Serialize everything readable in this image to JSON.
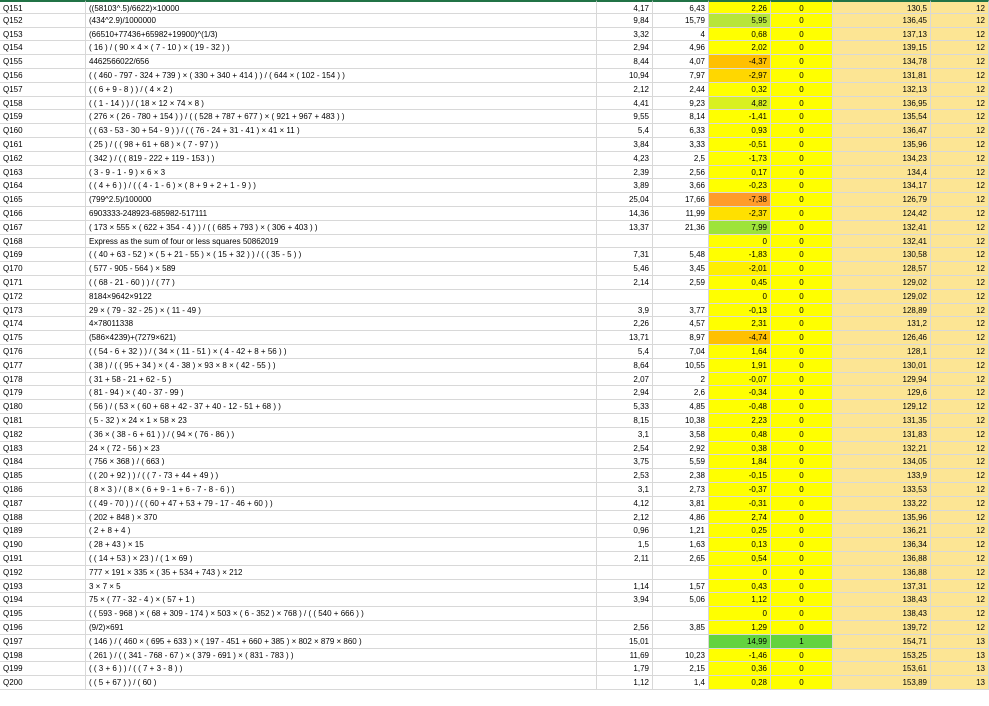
{
  "sheet": {
    "rows": [
      {
        "id": "Q151",
        "q": "((58103^.5)/6622)×10000",
        "n1": "4,17",
        "n2": "6,43",
        "diff": "2,26",
        "diff_color": "#ffff00",
        "flag": "0",
        "score": "130,5",
        "lvl": "12"
      },
      {
        "id": "Q152",
        "q": "(434^2.9)/1000000",
        "n1": "9,84",
        "n2": "15,79",
        "diff": "5,95",
        "diff_color": "#b7e53b",
        "flag": "0",
        "score": "136,45",
        "lvl": "12"
      },
      {
        "id": "Q153",
        "q": "(66510+77436+65982+19900)^(1/3)",
        "n1": "3,32",
        "n2": "4",
        "diff": "0,68",
        "diff_color": "#ffff00",
        "flag": "0",
        "score": "137,13",
        "lvl": "12"
      },
      {
        "id": "Q154",
        "q": "( 16 ) / ( 90 × 4 × ( 7 - 10 ) × ( 19 - 32 ) )",
        "n1": "2,94",
        "n2": "4,96",
        "diff": "2,02",
        "diff_color": "#ffff00",
        "flag": "0",
        "score": "139,15",
        "lvl": "12"
      },
      {
        "id": "Q155",
        "q": "4462566022/656",
        "n1": "8,44",
        "n2": "4,07",
        "diff": "-4,37",
        "diff_color": "#ffc000",
        "flag": "0",
        "score": "134,78",
        "lvl": "12"
      },
      {
        "id": "Q156",
        "q": "( ( 460 - 797 - 324 + 739 ) × ( 330 + 340 + 414 ) ) / ( 644 × ( 102 - 154 ) )",
        "n1": "10,94",
        "n2": "7,97",
        "diff": "-2,97",
        "diff_color": "#ffd700",
        "flag": "0",
        "score": "131,81",
        "lvl": "12"
      },
      {
        "id": "Q157",
        "q": "( ( 6 + 9 - 8 ) ) / ( 4 × 2 )",
        "n1": "2,12",
        "n2": "2,44",
        "diff": "0,32",
        "diff_color": "#ffff00",
        "flag": "0",
        "score": "132,13",
        "lvl": "12"
      },
      {
        "id": "Q158",
        "q": "( ( 1 - 14 ) ) / ( 18 × 12 × 74 × 8 )",
        "n1": "4,41",
        "n2": "9,23",
        "diff": "4,82",
        "diff_color": "#d9f020",
        "flag": "0",
        "score": "136,95",
        "lvl": "12"
      },
      {
        "id": "Q159",
        "q": "( 276 × ( 26 - 780 + 154 ) ) / ( ( 528 + 787 + 677 ) × ( 921 + 967 + 483 ) )",
        "n1": "9,55",
        "n2": "8,14",
        "diff": "-1,41",
        "diff_color": "#ffff00",
        "flag": "0",
        "score": "135,54",
        "lvl": "12"
      },
      {
        "id": "Q160",
        "q": "( ( 63 - 53 - 30 + 54 - 9 ) ) / ( ( 76 - 24 + 31 - 41 ) × 41 × 11 )",
        "n1": "5,4",
        "n2": "6,33",
        "diff": "0,93",
        "diff_color": "#ffff00",
        "flag": "0",
        "score": "136,47",
        "lvl": "12"
      },
      {
        "id": "Q161",
        "q": "( 25 ) / ( ( 98 + 61 + 68 ) × ( 7 - 97 ) )",
        "n1": "3,84",
        "n2": "3,33",
        "diff": "-0,51",
        "diff_color": "#ffff00",
        "flag": "0",
        "score": "135,96",
        "lvl": "12"
      },
      {
        "id": "Q162",
        "q": "( 342 ) / ( ( 819 - 222 + 119 - 153 ) )",
        "n1": "4,23",
        "n2": "2,5",
        "diff": "-1,73",
        "diff_color": "#ffff00",
        "flag": "0",
        "score": "134,23",
        "lvl": "12"
      },
      {
        "id": "Q163",
        "q": "( 3 - 9 - 1 - 9 ) × 6 × 3",
        "n1": "2,39",
        "n2": "2,56",
        "diff": "0,17",
        "diff_color": "#ffff00",
        "flag": "0",
        "score": "134,4",
        "lvl": "12"
      },
      {
        "id": "Q164",
        "q": "( ( 4 + 6 ) ) / ( ( 4 - 1 - 6 ) × ( 8 + 9 + 2 + 1 - 9 ) )",
        "n1": "3,89",
        "n2": "3,66",
        "diff": "-0,23",
        "diff_color": "#ffff00",
        "flag": "0",
        "score": "134,17",
        "lvl": "12"
      },
      {
        "id": "Q165",
        "q": "(799^2.5)/100000",
        "n1": "25,04",
        "n2": "17,66",
        "diff": "-7,38",
        "diff_color": "#ff9c2a",
        "flag": "0",
        "score": "126,79",
        "lvl": "12"
      },
      {
        "id": "Q166",
        "q": "6903333-248923-685982-517111",
        "n1": "14,36",
        "n2": "11,99",
        "diff": "-2,37",
        "diff_color": "#ffe000",
        "flag": "0",
        "score": "124,42",
        "lvl": "12"
      },
      {
        "id": "Q167",
        "q": "( 173 × 555 × ( 622 + 354 - 4 ) ) / ( ( 685 + 793 ) × ( 306 + 403 ) )",
        "n1": "13,37",
        "n2": "21,36",
        "diff": "7,99",
        "diff_color": "#9ee33a",
        "flag": "0",
        "score": "132,41",
        "lvl": "12"
      },
      {
        "id": "Q168",
        "q": "Express as the sum of four or less squares 50862019",
        "n1": "",
        "n2": "",
        "diff": "0",
        "diff_color": "#ffff00",
        "flag": "0",
        "score": "132,41",
        "lvl": "12"
      },
      {
        "id": "Q169",
        "q": "( ( 40 + 63 - 52 ) × ( 5 + 21 - 55 ) × ( 15 + 32 ) ) / ( ( 35 - 5 ) )",
        "n1": "7,31",
        "n2": "5,48",
        "diff": "-1,83",
        "diff_color": "#ffff00",
        "flag": "0",
        "score": "130,58",
        "lvl": "12"
      },
      {
        "id": "Q170",
        "q": "( 577 - 905 - 564 ) × 589",
        "n1": "5,46",
        "n2": "3,45",
        "diff": "-2,01",
        "diff_color": "#ffef00",
        "flag": "0",
        "score": "128,57",
        "lvl": "12"
      },
      {
        "id": "Q171",
        "q": "( ( 68 - 21 - 60 ) ) / ( 77 )",
        "n1": "2,14",
        "n2": "2,59",
        "diff": "0,45",
        "diff_color": "#ffff00",
        "flag": "0",
        "score": "129,02",
        "lvl": "12"
      },
      {
        "id": "Q172",
        "q": "8184×9642×9122",
        "n1": "",
        "n2": "",
        "diff": "0",
        "diff_color": "#ffff00",
        "flag": "0",
        "score": "129,02",
        "lvl": "12"
      },
      {
        "id": "Q173",
        "q": "29 × ( 79 - 32 - 25 ) × ( 11 - 49 )",
        "n1": "3,9",
        "n2": "3,77",
        "diff": "-0,13",
        "diff_color": "#ffff00",
        "flag": "0",
        "score": "128,89",
        "lvl": "12"
      },
      {
        "id": "Q174",
        "q": "4×78011338",
        "n1": "2,26",
        "n2": "4,57",
        "diff": "2,31",
        "diff_color": "#ffff00",
        "flag": "0",
        "score": "131,2",
        "lvl": "12"
      },
      {
        "id": "Q175",
        "q": "(586×4239)+(7279×621)",
        "n1": "13,71",
        "n2": "8,97",
        "diff": "-4,74",
        "diff_color": "#ffc000",
        "flag": "0",
        "score": "126,46",
        "lvl": "12"
      },
      {
        "id": "Q176",
        "q": "( ( 54 - 6 + 32 ) ) / ( 34 × ( 11 - 51 ) × ( 4 - 42 + 8 + 56 ) )",
        "n1": "5,4",
        "n2": "7,04",
        "diff": "1,64",
        "diff_color": "#ffff00",
        "flag": "0",
        "score": "128,1",
        "lvl": "12"
      },
      {
        "id": "Q177",
        "q": "( 38 ) / ( ( 95 + 34 ) × ( 4 - 38 ) × 93 × 8 × ( 42 - 55 ) )",
        "n1": "8,64",
        "n2": "10,55",
        "diff": "1,91",
        "diff_color": "#ffff00",
        "flag": "0",
        "score": "130,01",
        "lvl": "12"
      },
      {
        "id": "Q178",
        "q": "( 31 + 58 - 21 + 62 - 5 )",
        "n1": "2,07",
        "n2": "2",
        "diff": "-0,07",
        "diff_color": "#ffff00",
        "flag": "0",
        "score": "129,94",
        "lvl": "12"
      },
      {
        "id": "Q179",
        "q": "( 81 - 94 ) × ( 40 - 37 - 99 )",
        "n1": "2,94",
        "n2": "2,6",
        "diff": "-0,34",
        "diff_color": "#ffff00",
        "flag": "0",
        "score": "129,6",
        "lvl": "12"
      },
      {
        "id": "Q180",
        "q": "( 56 ) / ( 53 × ( 60 + 68 + 42 - 37 + 40 - 12 - 51 + 68 ) )",
        "n1": "5,33",
        "n2": "4,85",
        "diff": "-0,48",
        "diff_color": "#ffff00",
        "flag": "0",
        "score": "129,12",
        "lvl": "12"
      },
      {
        "id": "Q181",
        "q": "( 5 - 32 ) × 24 × 1 × 58 × 23",
        "n1": "8,15",
        "n2": "10,38",
        "diff": "2,23",
        "diff_color": "#ffff00",
        "flag": "0",
        "score": "131,35",
        "lvl": "12"
      },
      {
        "id": "Q182",
        "q": "( 36 × ( 38 - 6 + 61 ) ) / ( 94 × ( 76 - 86 ) )",
        "n1": "3,1",
        "n2": "3,58",
        "diff": "0,48",
        "diff_color": "#ffff00",
        "flag": "0",
        "score": "131,83",
        "lvl": "12"
      },
      {
        "id": "Q183",
        "q": "24 × ( 72 - 56 ) × 23",
        "n1": "2,54",
        "n2": "2,92",
        "diff": "0,38",
        "diff_color": "#ffff00",
        "flag": "0",
        "score": "132,21",
        "lvl": "12"
      },
      {
        "id": "Q184",
        "q": "( 756 × 368 ) / ( 663 )",
        "n1": "3,75",
        "n2": "5,59",
        "diff": "1,84",
        "diff_color": "#ffff00",
        "flag": "0",
        "score": "134,05",
        "lvl": "12"
      },
      {
        "id": "Q185",
        "q": "( ( 20 + 92 ) ) / ( ( 7 - 73 + 44 + 49 ) )",
        "n1": "2,53",
        "n2": "2,38",
        "diff": "-0,15",
        "diff_color": "#ffff00",
        "flag": "0",
        "score": "133,9",
        "lvl": "12"
      },
      {
        "id": "Q186",
        "q": "( 8 × 3 ) / ( 8 × ( 6 + 9 - 1 + 6 - 7 - 8 - 6 ) )",
        "n1": "3,1",
        "n2": "2,73",
        "diff": "-0,37",
        "diff_color": "#ffff00",
        "flag": "0",
        "score": "133,53",
        "lvl": "12"
      },
      {
        "id": "Q187",
        "q": "( ( 49 - 70 ) ) / ( ( 60 + 47 + 53 + 79 - 17 - 46 + 60 ) )",
        "n1": "4,12",
        "n2": "3,81",
        "diff": "-0,31",
        "diff_color": "#ffff00",
        "flag": "0",
        "score": "133,22",
        "lvl": "12"
      },
      {
        "id": "Q188",
        "q": "( 202 + 848 ) × 370",
        "n1": "2,12",
        "n2": "4,86",
        "diff": "2,74",
        "diff_color": "#ffff00",
        "flag": "0",
        "score": "135,96",
        "lvl": "12"
      },
      {
        "id": "Q189",
        "q": "( 2 + 8 + 4 )",
        "n1": "0,96",
        "n2": "1,21",
        "diff": "0,25",
        "diff_color": "#ffff00",
        "flag": "0",
        "score": "136,21",
        "lvl": "12"
      },
      {
        "id": "Q190",
        "q": "( 28 + 43 ) × 15",
        "n1": "1,5",
        "n2": "1,63",
        "diff": "0,13",
        "diff_color": "#ffff00",
        "flag": "0",
        "score": "136,34",
        "lvl": "12"
      },
      {
        "id": "Q191",
        "q": "( ( 14 + 53 ) × 23 ) / ( 1 × 69 )",
        "n1": "2,11",
        "n2": "2,65",
        "diff": "0,54",
        "diff_color": "#ffff00",
        "flag": "0",
        "score": "136,88",
        "lvl": "12"
      },
      {
        "id": "Q192",
        "q": "777 × 191 × 335 × ( 35 + 534 + 743 ) × 212",
        "n1": "",
        "n2": "",
        "diff": "0",
        "diff_color": "#ffff00",
        "flag": "0",
        "score": "136,88",
        "lvl": "12"
      },
      {
        "id": "Q193",
        "q": "3 × 7 × 5",
        "n1": "1,14",
        "n2": "1,57",
        "diff": "0,43",
        "diff_color": "#ffff00",
        "flag": "0",
        "score": "137,31",
        "lvl": "12"
      },
      {
        "id": "Q194",
        "q": "75 × ( 77 - 32 - 4 ) × ( 57 + 1 )",
        "n1": "3,94",
        "n2": "5,06",
        "diff": "1,12",
        "diff_color": "#ffff00",
        "flag": "0",
        "score": "138,43",
        "lvl": "12"
      },
      {
        "id": "Q195",
        "q": "( ( 593 - 968 ) × ( 68 + 309 - 174 ) × 503 × ( 6 - 352 ) × 768 ) / ( ( 540 + 666 ) )",
        "n1": "",
        "n2": "",
        "diff": "0",
        "diff_color": "#ffff00",
        "flag": "0",
        "score": "138,43",
        "lvl": "12"
      },
      {
        "id": "Q196",
        "q": "(9/2)×691",
        "n1": "2,56",
        "n2": "3,85",
        "diff": "1,29",
        "diff_color": "#ffff00",
        "flag": "0",
        "score": "139,72",
        "lvl": "12"
      },
      {
        "id": "Q197",
        "q": "( 146 ) / ( 460 × ( 695 + 633 ) × ( 197 - 451 + 660 + 385 ) × 802 × 879 × 860 )",
        "n1": "15,01",
        "n2": "",
        "diff": "14,99",
        "diff_color": "#63d33f",
        "flag": "1",
        "flag_color": "#63d33f",
        "score": "154,71",
        "lvl": "13"
      },
      {
        "id": "Q198",
        "q": "( 261 ) / ( ( 341 - 768 - 67 ) × ( 379 - 691 ) × ( 831 - 783 ) )",
        "n1": "11,69",
        "n2": "10,23",
        "diff": "-1,46",
        "diff_color": "#ffff00",
        "flag": "0",
        "score": "153,25",
        "lvl": "13"
      },
      {
        "id": "Q199",
        "q": "( ( 3 + 6 ) ) / ( ( 7 + 3 - 8 ) )",
        "n1": "1,79",
        "n2": "2,15",
        "diff": "0,36",
        "diff_color": "#ffff00",
        "flag": "0",
        "score": "153,61",
        "lvl": "13"
      },
      {
        "id": "Q200",
        "q": "( ( 5 + 67 ) ) / ( 60 )",
        "n1": "1,12",
        "n2": "1,4",
        "diff": "0,28",
        "diff_color": "#ffff00",
        "flag": "0",
        "score": "153,89",
        "lvl": "13"
      }
    ]
  }
}
